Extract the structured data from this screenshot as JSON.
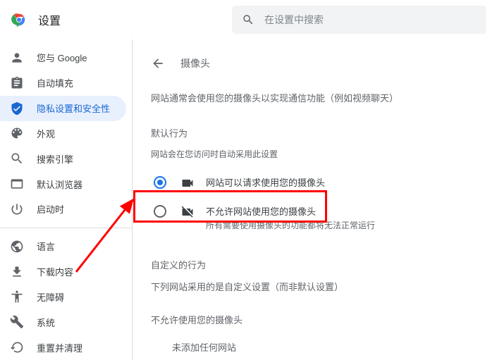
{
  "header": {
    "title": "设置",
    "search_placeholder": "在设置中搜索"
  },
  "sidebar": {
    "groups": [
      [
        {
          "key": "you-google",
          "label": "您与 Google"
        },
        {
          "key": "autofill",
          "label": "自动填充"
        },
        {
          "key": "privacy",
          "label": "隐私设置和安全性"
        },
        {
          "key": "appearance",
          "label": "外观"
        },
        {
          "key": "search-engine",
          "label": "搜索引擎"
        },
        {
          "key": "default-browser",
          "label": "默认浏览器"
        },
        {
          "key": "on-startup",
          "label": "启动时"
        }
      ],
      [
        {
          "key": "languages",
          "label": "语言"
        },
        {
          "key": "downloads",
          "label": "下载内容"
        },
        {
          "key": "accessibility",
          "label": "无障碍"
        },
        {
          "key": "system",
          "label": "系统"
        },
        {
          "key": "reset",
          "label": "重置并清理"
        }
      ]
    ],
    "selected": "privacy"
  },
  "main": {
    "crumb": "摄像头",
    "desc": "网站通常会使用您的摄像头以实现通信功能（例如视频聊天）",
    "default_h": "默认行为",
    "default_sub": "网站会在您访问时自动采用此设置",
    "opt_ask": "网站可以请求使用您的摄像头",
    "opt_block": "不允许网站使用您的摄像头",
    "opt_block_sub": "所有需要使用摄像头的功能都将无法正常运行",
    "custom_h": "自定义的行为",
    "custom_sub": "下列网站采用的是自定义设置（而非默认设置）",
    "block_h": "不允许使用您的摄像头",
    "empty": "未添加任何网站"
  }
}
